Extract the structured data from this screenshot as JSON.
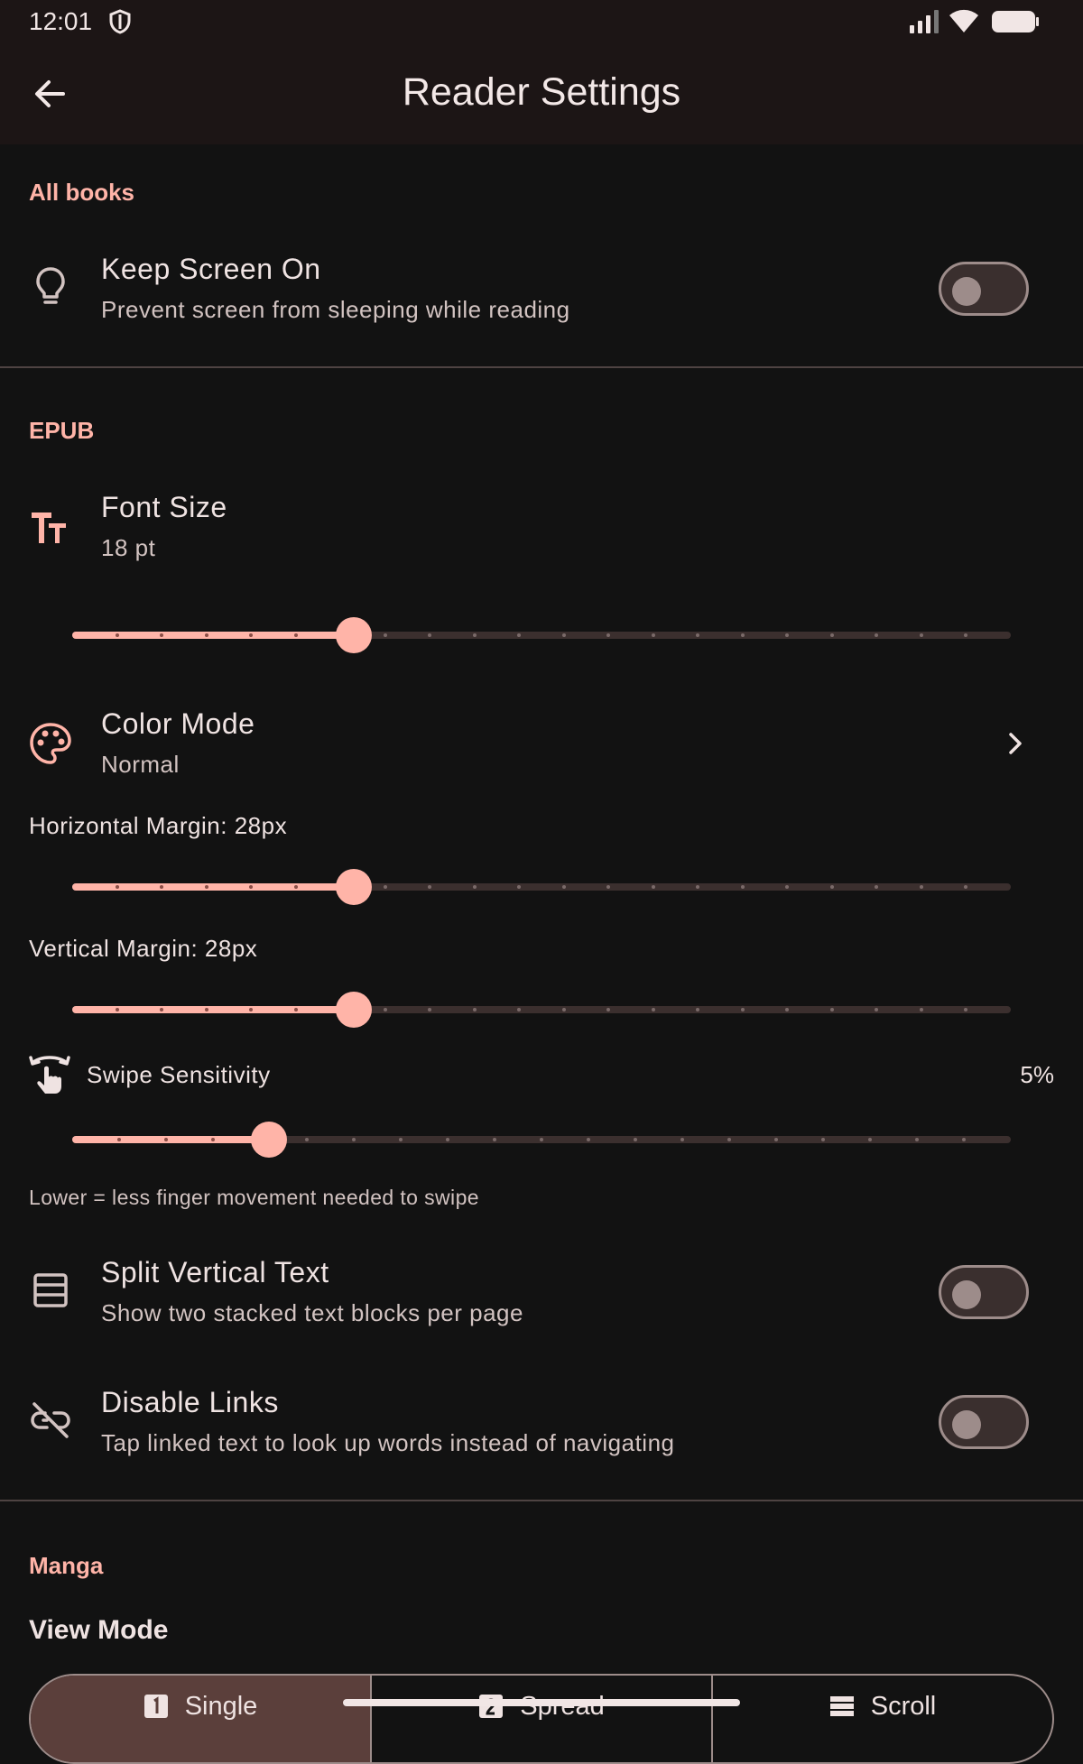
{
  "status_bar": {
    "time": "12:01"
  },
  "app_bar": {
    "title": "Reader Settings"
  },
  "sections": {
    "all_books": "All books",
    "epub": "EPUB",
    "manga": "Manga"
  },
  "keep_screen_on": {
    "title": "Keep Screen On",
    "subtitle": "Prevent screen from sleeping while reading",
    "enabled": false
  },
  "font_size": {
    "title": "Font Size",
    "subtitle": "18 pt",
    "slider": {
      "value_fraction": 0.3,
      "tick_count": 21
    }
  },
  "color_mode": {
    "title": "Color Mode",
    "subtitle": "Normal"
  },
  "horizontal_margin": {
    "label": "Horizontal Margin: 28px",
    "slider": {
      "value_fraction": 0.3,
      "tick_count": 21
    }
  },
  "vertical_margin": {
    "label": "Vertical Margin: 28px",
    "slider": {
      "value_fraction": 0.3,
      "tick_count": 21
    }
  },
  "swipe_sensitivity": {
    "label": "Swipe Sensitivity",
    "value": "5%",
    "help": "Lower = less finger movement needed to swipe",
    "slider": {
      "value_fraction": 0.21,
      "tick_count": 20
    }
  },
  "split_vertical_text": {
    "title": "Split Vertical Text",
    "subtitle": "Show two stacked text blocks per page",
    "enabled": false
  },
  "disable_links": {
    "title": "Disable Links",
    "subtitle": "Tap linked text to look up words instead of navigating",
    "enabled": false
  },
  "view_mode": {
    "label": "View Mode",
    "options": [
      "Single",
      "Spread",
      "Scroll"
    ],
    "selected": "Single"
  },
  "colors": {
    "accent": "#ffb4a8",
    "surface": "#121212",
    "app_bar": "#1c1515"
  }
}
